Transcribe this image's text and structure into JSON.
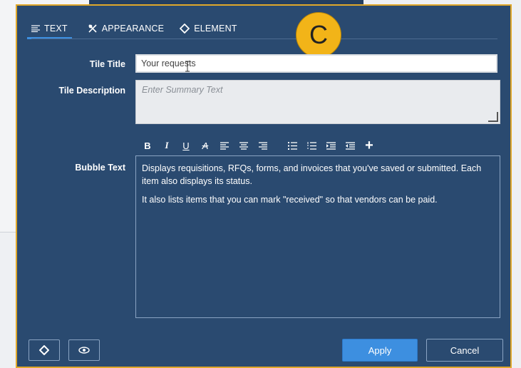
{
  "tabs": [
    {
      "label": "TEXT",
      "icon": "text-lines-icon",
      "active": true
    },
    {
      "label": "APPEARANCE",
      "icon": "brush-icon",
      "active": false
    },
    {
      "label": "ELEMENT",
      "icon": "diamond-icon",
      "active": false
    }
  ],
  "step_badge": "C",
  "form": {
    "tile_title_label": "Tile Title",
    "tile_title_value": "Your requests",
    "tile_description_label": "Tile Description",
    "tile_description_placeholder": "Enter Summary Text",
    "bubble_text_label": "Bubble Text",
    "bubble_text_paragraphs": [
      "Displays requisitions, RFQs, forms, and invoices that you've saved or submitted. Each item also displays its status.",
      "It also lists items that you can mark \"received\" so that vendors can be paid."
    ]
  },
  "toolbar": {
    "bold": "B",
    "italic": "I",
    "underline": "U",
    "strike": "A",
    "plus": "+"
  },
  "footer": {
    "apply_label": "Apply",
    "cancel_label": "Cancel"
  },
  "colors": {
    "dialog_bg": "#2a4a70",
    "accent_blue": "#3d8fe0",
    "badge_orange": "#f2b418",
    "border_highlight": "#e0a82a"
  }
}
